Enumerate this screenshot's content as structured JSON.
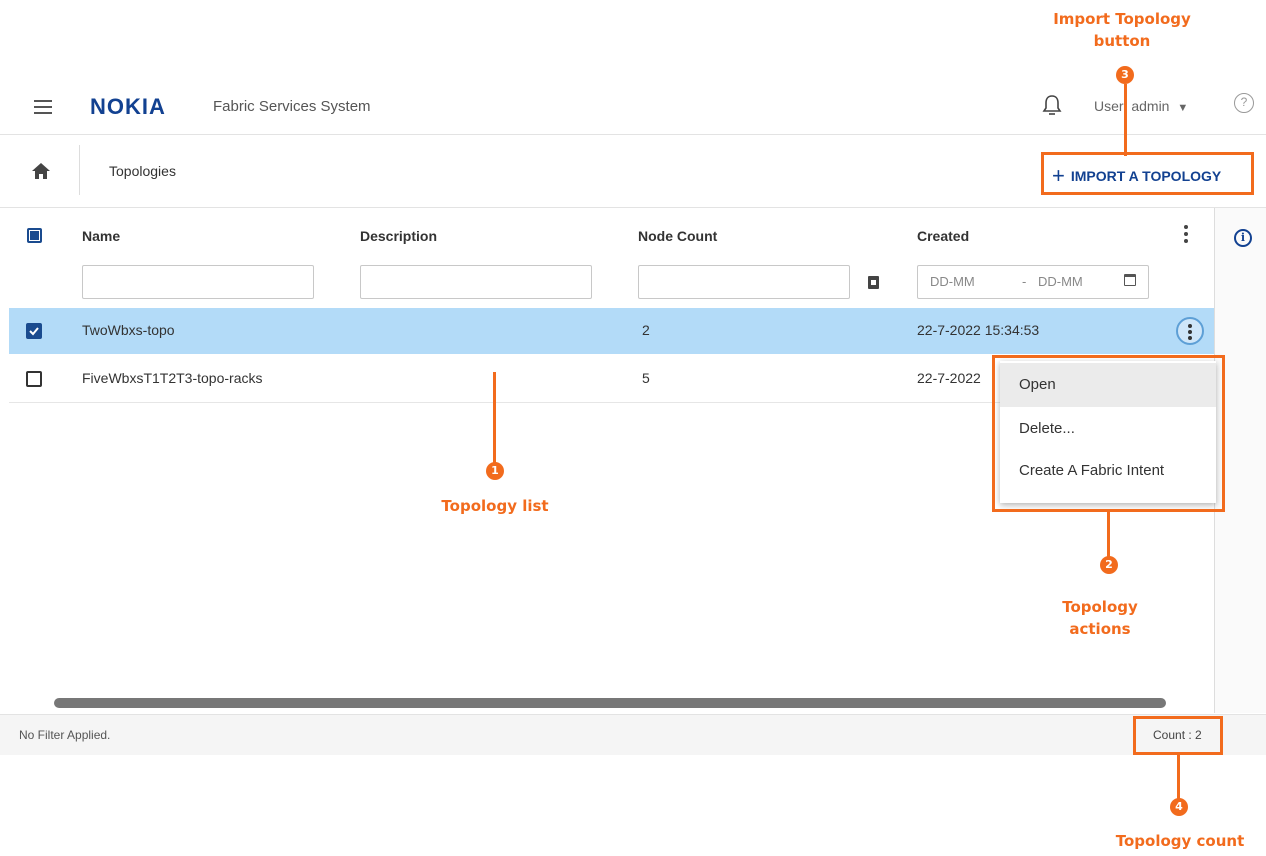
{
  "header": {
    "logo": "NOKIA",
    "app_title": "Fabric Services System",
    "user_label": "User: admin"
  },
  "toolbar": {
    "breadcrumb": "Topologies",
    "import_label": "IMPORT A TOPOLOGY"
  },
  "table": {
    "columns": [
      "Name",
      "Description",
      "Node Count",
      "Created"
    ],
    "date_from_placeholder": "DD-MM",
    "date_separator": "-",
    "date_to_placeholder": "DD-MM",
    "rows": [
      {
        "name": "TwoWbxs-topo",
        "node_count": "2",
        "created": "22-7-2022 15:34:53",
        "selected": true
      },
      {
        "name": "FiveWbxsT1T2T3-topo-racks",
        "node_count": "5",
        "created": "22-7-2022",
        "selected": false
      }
    ]
  },
  "context_menu": {
    "items": [
      "Open",
      "Delete...",
      "Create A Fabric Intent"
    ]
  },
  "footer": {
    "filter_status": "No Filter Applied.",
    "count": "Count : 2"
  },
  "annotations": {
    "import_button": {
      "number": "3",
      "label_line1": "Import Topology",
      "label_line2": "button"
    },
    "topology_list": {
      "number": "1",
      "label": "Topology list"
    },
    "topology_actions": {
      "number": "2",
      "label_line1": "Topology",
      "label_line2": "actions"
    },
    "topology_count": {
      "number": "4",
      "label": "Topology count"
    }
  },
  "colors": {
    "accent_orange": "#f26b1d",
    "nokia_blue": "#124191",
    "selected_row": "#b3dbf8",
    "checkbox_blue": "#1a4b8f"
  },
  "icons": [
    "hamburger-icon",
    "bell-icon",
    "caret-down-icon",
    "help-icon",
    "home-icon",
    "plus-icon",
    "kebab-icon",
    "export-icon",
    "calendar-icon",
    "info-icon",
    "checkbox-icon"
  ]
}
